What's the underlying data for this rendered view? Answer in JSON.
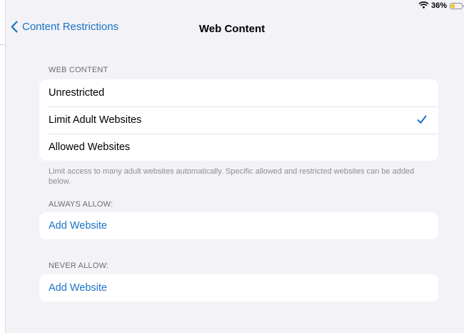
{
  "status_bar": {
    "battery_text": "36%",
    "battery_level": 0.36,
    "wifi_icon": "wifi-icon",
    "battery_color": "#f5c518"
  },
  "nav": {
    "back_label": "Content Restrictions",
    "title": "Web Content"
  },
  "web_content": {
    "header": "WEB CONTENT",
    "options": [
      {
        "label": "Unrestricted",
        "selected": false
      },
      {
        "label": "Limit Adult Websites",
        "selected": true
      },
      {
        "label": "Allowed Websites",
        "selected": false
      }
    ],
    "footer": "Limit access to many adult websites automatically. Specific allowed and restricted websites can be added below."
  },
  "always_allow": {
    "header": "ALWAYS ALLOW:",
    "add_label": "Add Website"
  },
  "never_allow": {
    "header": "NEVER ALLOW:",
    "add_label": "Add Website"
  },
  "colors": {
    "accent": "#1a73c6",
    "background": "#f2f2f7",
    "card": "#ffffff"
  }
}
